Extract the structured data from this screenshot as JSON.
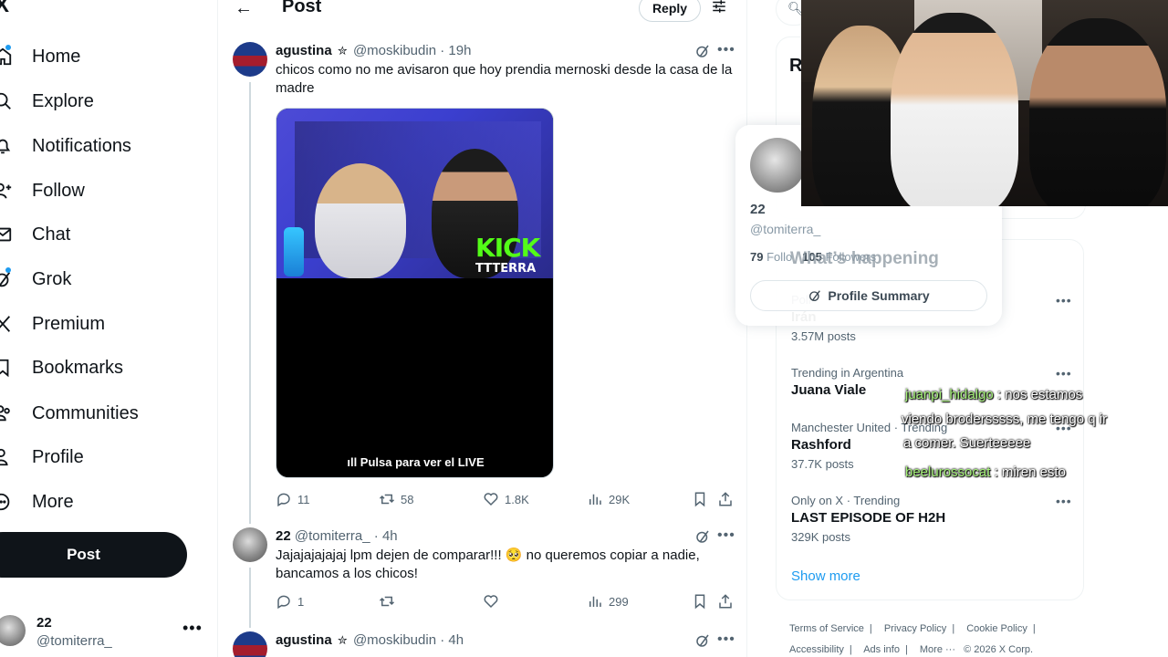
{
  "nav": {
    "logo": "X",
    "items": [
      {
        "label": "Home",
        "icon": "home-icon",
        "dot": true
      },
      {
        "label": "Explore",
        "icon": "search-icon",
        "dot": false
      },
      {
        "label": "Notifications",
        "icon": "bell-icon",
        "dot": false
      },
      {
        "label": "Follow",
        "icon": "add-user-icon",
        "dot": false
      },
      {
        "label": "Chat",
        "icon": "envelope-icon",
        "dot": false
      },
      {
        "label": "Grok",
        "icon": "grok-icon",
        "dot": true
      },
      {
        "label": "Premium",
        "icon": "x-logo-icon",
        "dot": false
      },
      {
        "label": "Bookmarks",
        "icon": "bookmark-icon",
        "dot": false
      },
      {
        "label": "Communities",
        "icon": "people-icon",
        "dot": false
      },
      {
        "label": "Profile",
        "icon": "person-icon",
        "dot": false
      },
      {
        "label": "More",
        "icon": "more-circle-icon",
        "dot": false
      }
    ],
    "post_label": "Post",
    "account": {
      "name": "22",
      "handle": "@tomiterra_",
      "more": "•••"
    }
  },
  "header": {
    "back": "←",
    "title": "Post",
    "reply_label": "Reply"
  },
  "tweets": [
    {
      "name": "agustina",
      "badge": "✮",
      "handle": "@moskibudin",
      "time": "· 19h",
      "text": "chicos como no me avisaron que hoy prendia mernoski desde la casa de la madre",
      "media": {
        "logo": "KICK",
        "channel": "TTTERRA",
        "cta": "ıll Pulsa para ver el LIVE"
      },
      "stats": {
        "replies": "11",
        "reposts": "58",
        "likes": "1.8K",
        "views": "29K"
      }
    },
    {
      "name": "22",
      "handle": "@tomiterra_",
      "time": "· 4h",
      "text": "Jajajajajajaj lpm dejen de comparar!!! 🥺 no queremos copiar a nadie, bancamos a los chicos!",
      "stats": {
        "replies": "1",
        "reposts": "",
        "likes": "",
        "views": "299"
      }
    },
    {
      "name": "agustina",
      "badge": "✮",
      "handle": "@moskibudin",
      "time": "· 4h"
    }
  ],
  "right": {
    "search_icon": "search-icon",
    "relevant_title": "R",
    "hover_card": {
      "name": "22",
      "handle": "@tomiterra_",
      "following_count": "79",
      "following_label": "Follo",
      "followers_count": "105",
      "followers_label": "Followers",
      "button_label": "Profile Summary"
    },
    "trending_title": "What’s happening",
    "trends": [
      {
        "context": "Poli",
        "name": "Irán",
        "count": "3.57M posts"
      },
      {
        "context": "Trending in Argentina",
        "name": "Juana Viale",
        "count": ""
      },
      {
        "context": "Manchester United · Trending",
        "name": "Rashford",
        "count": "37.7K posts"
      },
      {
        "context": "Only on X · Trending",
        "name": "LAST EPISODE OF H2H",
        "count": "329K posts"
      }
    ],
    "show_more": "Show more",
    "footer": [
      "Terms of Service",
      "Privacy Policy",
      "Cookie Policy",
      "Accessibility",
      "Ads info",
      "More ···",
      "© 2026 X Corp."
    ]
  },
  "chat": [
    {
      "user": "juanpi_hidalgo",
      "line1": " : nos estamos",
      "line2": "viendo brodersssss, me tengo q ir",
      "line3": "a comer. Suerteeeee"
    },
    {
      "user": "beelurossocat",
      "line1": " : miren esto"
    }
  ],
  "colors": {
    "accent": "#1d9bf0",
    "text": "#0f1419",
    "muted": "#536471",
    "kick": "#53fc18"
  }
}
